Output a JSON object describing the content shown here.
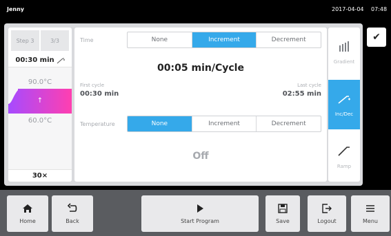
{
  "statusbar": {
    "user": "Jenny",
    "date": "2017-04-04",
    "time": "07:48"
  },
  "left_panel": {
    "step_label": "Step 3",
    "step_count": "3/3",
    "step_time": "00:30 min",
    "temp_high": "90.0°C",
    "temp_low": "60.0°C",
    "cycles": "30×"
  },
  "editor": {
    "time_label": "Time",
    "time_options": [
      "None",
      "Increment",
      "Decrement"
    ],
    "time_selected": "Increment",
    "value": "00:05 min/Cycle",
    "first_cycle_label": "First cycle",
    "first_cycle_value": "00:30 min",
    "last_cycle_label": "Last cycle",
    "last_cycle_value": "02:55 min",
    "temp_label": "Temperature",
    "temp_options": [
      "None",
      "Increment",
      "Decrement"
    ],
    "temp_selected": "None",
    "temp_value": "Off"
  },
  "tools": [
    {
      "label": "Gradient",
      "icon": "gradient-icon",
      "active": false
    },
    {
      "label": "Inc/Dec",
      "icon": "incdec-icon",
      "active": true
    },
    {
      "label": "Ramp",
      "icon": "ramp-icon",
      "active": false
    }
  ],
  "bottom": {
    "home": "Home",
    "back": "Back",
    "start": "Start Program",
    "save": "Save",
    "logout": "Logout",
    "menu": "Menu"
  },
  "colors": {
    "accent": "#35a9ea",
    "ramp_gradient": [
      "#a64bff",
      "#ff3fb0"
    ],
    "panel_bg": "#d9dadd"
  }
}
